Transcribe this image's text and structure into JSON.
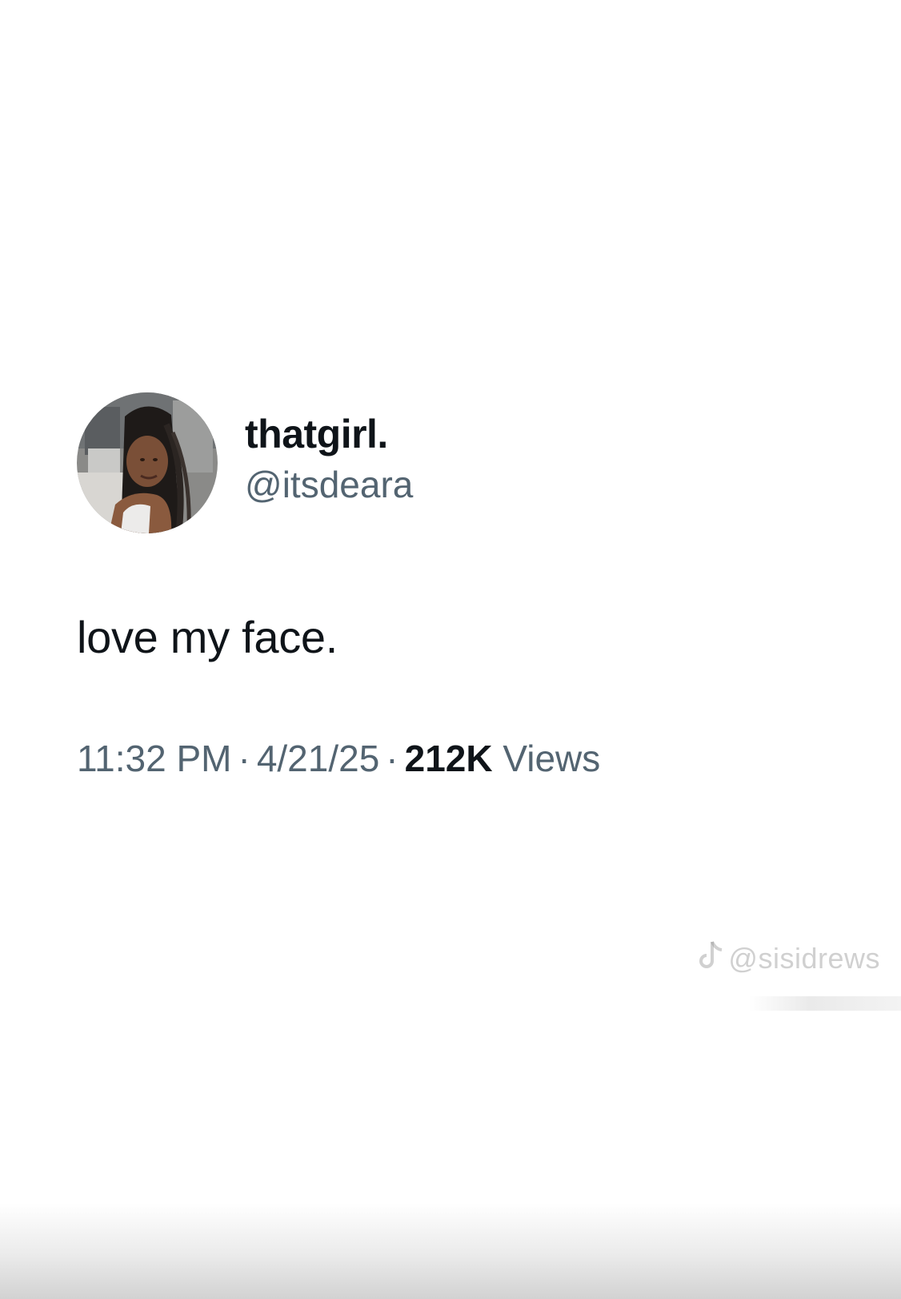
{
  "tweet": {
    "display_name": "thatgirl.",
    "handle": "@itsdeara",
    "text": "love my face.",
    "time": "11:32 PM",
    "separator": "·",
    "date": "4/21/25",
    "views_count": "212K",
    "views_label": "Views"
  },
  "watermark": {
    "icon": "tiktok-note-icon",
    "handle": "@sisidrews"
  },
  "colors": {
    "primary_text": "#0f1419",
    "secondary_text": "#536471",
    "background": "#ffffff"
  }
}
